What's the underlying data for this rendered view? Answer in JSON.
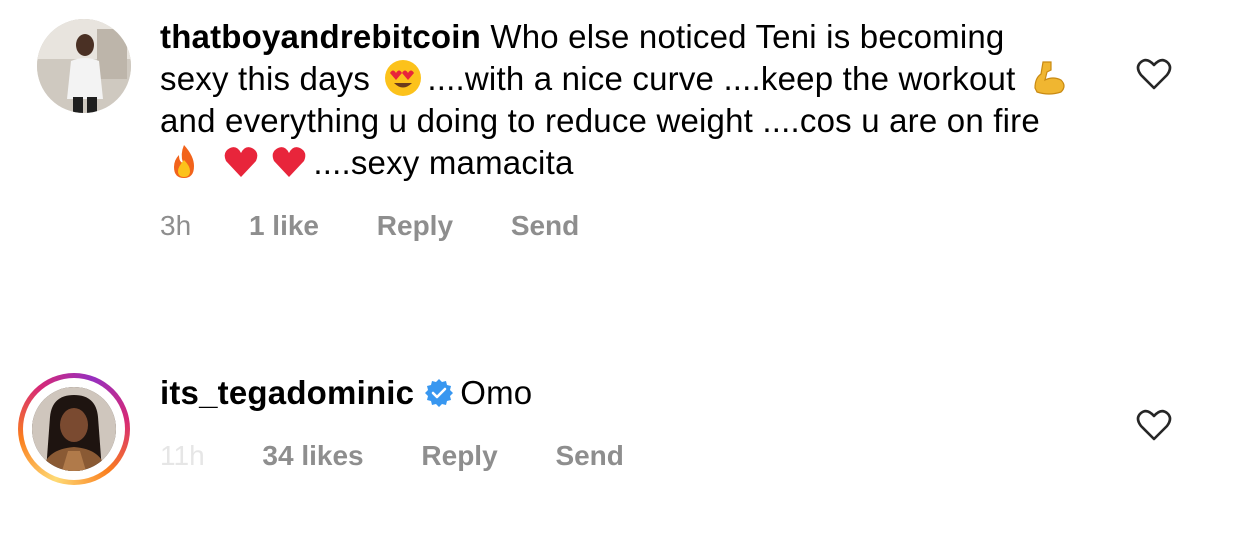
{
  "comments": [
    {
      "username": "thatboyandrebitcoin",
      "text_parts": [
        "Who else noticed Teni is becoming sexy this days ",
        "....with a nice curve ....keep the workout ",
        " and everything u doing to reduce weight ....cos u are on fire ",
        " ",
        "",
        "....sexy mamacita"
      ],
      "emojis": [
        "heart-eyes-emoji",
        "flexed-biceps-emoji",
        "fire-emoji",
        "red-heart-emoji",
        "red-heart-emoji"
      ],
      "time": "3h",
      "likes": "1 like",
      "reply_label": "Reply",
      "send_label": "Send",
      "verified": false
    },
    {
      "username": "its_tegadominic",
      "text": "Omo",
      "time": "11h",
      "likes": "34 likes",
      "reply_label": "Reply",
      "send_label": "Send",
      "verified": true
    }
  ],
  "colors": {
    "meta_text": "#8e8e8e",
    "verified_badge": "#3897f0"
  }
}
